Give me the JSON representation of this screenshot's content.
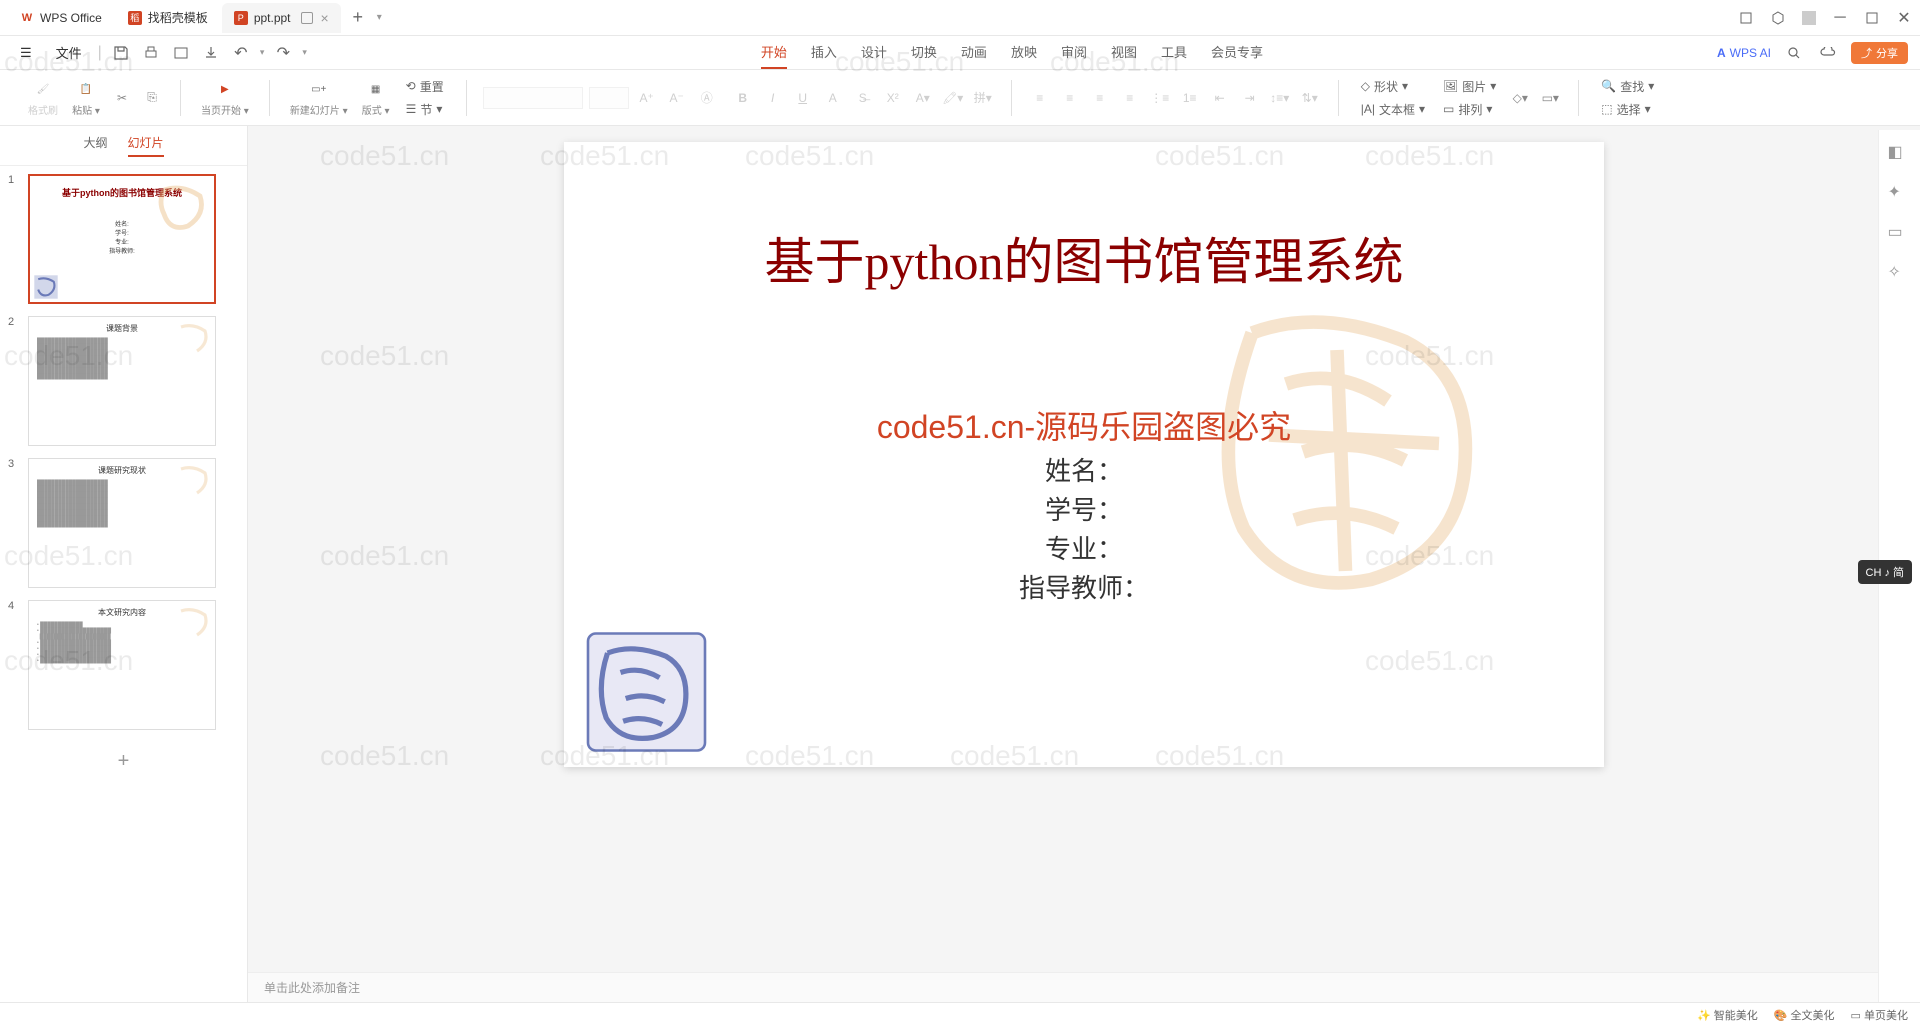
{
  "title_tabs": [
    {
      "icon": "wps",
      "label": "WPS Office",
      "active": false
    },
    {
      "icon": "template",
      "label": "找稻壳模板",
      "active": false
    },
    {
      "icon": "ppt",
      "label": "ppt.ppt",
      "active": true
    }
  ],
  "menu": {
    "file": "文件",
    "tabs": [
      "开始",
      "插入",
      "设计",
      "切换",
      "动画",
      "放映",
      "审阅",
      "视图",
      "工具",
      "会员专享"
    ],
    "active_tab": "开始",
    "wps_ai": "WPS AI",
    "share": "分享"
  },
  "ribbon": {
    "format_painter": "格式刷",
    "paste": "粘贴",
    "from_current": "当页开始",
    "new_slide": "新建幻灯片",
    "layout": "版式",
    "sections": "节",
    "reset": "重置",
    "shape": "形状",
    "picture": "图片",
    "textbox": "文本框",
    "arrange": "排列",
    "find": "查找",
    "select": "选择"
  },
  "side": {
    "outline": "大纲",
    "slides": "幻灯片"
  },
  "thumbnails": [
    {
      "num": "1",
      "title": "基于python的图书馆管理系统",
      "type": "title",
      "fields": "姓名:\n学号:\n专业:\n指导教师:"
    },
    {
      "num": "2",
      "title": "课题背景",
      "type": "content"
    },
    {
      "num": "3",
      "title": "课题研究现状",
      "type": "content"
    },
    {
      "num": "4",
      "title": "本文研究内容",
      "type": "content"
    }
  ],
  "slide": {
    "title": "基于python的图书馆管理系统",
    "watermark_text": "code51.cn-源码乐园盗图必究",
    "field_name": "姓名：",
    "field_id": "学号：",
    "field_major": "专业：",
    "field_advisor": "指导教师："
  },
  "notes": "单击此处添加备注",
  "watermark": "code51.cn",
  "ime": "CH ♪ 简",
  "status": {
    "smart": "智能美化",
    "theme": "全文美化",
    "layout": "单页美化"
  }
}
